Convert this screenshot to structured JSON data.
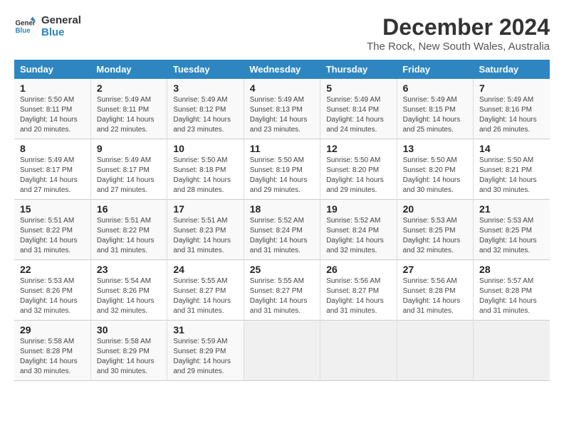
{
  "logo": {
    "line1": "General",
    "line2": "Blue"
  },
  "title": "December 2024",
  "location": "The Rock, New South Wales, Australia",
  "days_of_week": [
    "Sunday",
    "Monday",
    "Tuesday",
    "Wednesday",
    "Thursday",
    "Friday",
    "Saturday"
  ],
  "weeks": [
    [
      {
        "day": "1",
        "sunrise": "5:50 AM",
        "sunset": "8:11 PM",
        "daylight": "14 hours and 20 minutes."
      },
      {
        "day": "2",
        "sunrise": "5:49 AM",
        "sunset": "8:11 PM",
        "daylight": "14 hours and 22 minutes."
      },
      {
        "day": "3",
        "sunrise": "5:49 AM",
        "sunset": "8:12 PM",
        "daylight": "14 hours and 23 minutes."
      },
      {
        "day": "4",
        "sunrise": "5:49 AM",
        "sunset": "8:13 PM",
        "daylight": "14 hours and 23 minutes."
      },
      {
        "day": "5",
        "sunrise": "5:49 AM",
        "sunset": "8:14 PM",
        "daylight": "14 hours and 24 minutes."
      },
      {
        "day": "6",
        "sunrise": "5:49 AM",
        "sunset": "8:15 PM",
        "daylight": "14 hours and 25 minutes."
      },
      {
        "day": "7",
        "sunrise": "5:49 AM",
        "sunset": "8:16 PM",
        "daylight": "14 hours and 26 minutes."
      }
    ],
    [
      {
        "day": "8",
        "sunrise": "5:49 AM",
        "sunset": "8:17 PM",
        "daylight": "14 hours and 27 minutes."
      },
      {
        "day": "9",
        "sunrise": "5:49 AM",
        "sunset": "8:17 PM",
        "daylight": "14 hours and 27 minutes."
      },
      {
        "day": "10",
        "sunrise": "5:50 AM",
        "sunset": "8:18 PM",
        "daylight": "14 hours and 28 minutes."
      },
      {
        "day": "11",
        "sunrise": "5:50 AM",
        "sunset": "8:19 PM",
        "daylight": "14 hours and 29 minutes."
      },
      {
        "day": "12",
        "sunrise": "5:50 AM",
        "sunset": "8:20 PM",
        "daylight": "14 hours and 29 minutes."
      },
      {
        "day": "13",
        "sunrise": "5:50 AM",
        "sunset": "8:20 PM",
        "daylight": "14 hours and 30 minutes."
      },
      {
        "day": "14",
        "sunrise": "5:50 AM",
        "sunset": "8:21 PM",
        "daylight": "14 hours and 30 minutes."
      }
    ],
    [
      {
        "day": "15",
        "sunrise": "5:51 AM",
        "sunset": "8:22 PM",
        "daylight": "14 hours and 31 minutes."
      },
      {
        "day": "16",
        "sunrise": "5:51 AM",
        "sunset": "8:22 PM",
        "daylight": "14 hours and 31 minutes."
      },
      {
        "day": "17",
        "sunrise": "5:51 AM",
        "sunset": "8:23 PM",
        "daylight": "14 hours and 31 minutes."
      },
      {
        "day": "18",
        "sunrise": "5:52 AM",
        "sunset": "8:24 PM",
        "daylight": "14 hours and 31 minutes."
      },
      {
        "day": "19",
        "sunrise": "5:52 AM",
        "sunset": "8:24 PM",
        "daylight": "14 hours and 32 minutes."
      },
      {
        "day": "20",
        "sunrise": "5:53 AM",
        "sunset": "8:25 PM",
        "daylight": "14 hours and 32 minutes."
      },
      {
        "day": "21",
        "sunrise": "5:53 AM",
        "sunset": "8:25 PM",
        "daylight": "14 hours and 32 minutes."
      }
    ],
    [
      {
        "day": "22",
        "sunrise": "5:53 AM",
        "sunset": "8:26 PM",
        "daylight": "14 hours and 32 minutes."
      },
      {
        "day": "23",
        "sunrise": "5:54 AM",
        "sunset": "8:26 PM",
        "daylight": "14 hours and 32 minutes."
      },
      {
        "day": "24",
        "sunrise": "5:55 AM",
        "sunset": "8:27 PM",
        "daylight": "14 hours and 31 minutes."
      },
      {
        "day": "25",
        "sunrise": "5:55 AM",
        "sunset": "8:27 PM",
        "daylight": "14 hours and 31 minutes."
      },
      {
        "day": "26",
        "sunrise": "5:56 AM",
        "sunset": "8:27 PM",
        "daylight": "14 hours and 31 minutes."
      },
      {
        "day": "27",
        "sunrise": "5:56 AM",
        "sunset": "8:28 PM",
        "daylight": "14 hours and 31 minutes."
      },
      {
        "day": "28",
        "sunrise": "5:57 AM",
        "sunset": "8:28 PM",
        "daylight": "14 hours and 31 minutes."
      }
    ],
    [
      {
        "day": "29",
        "sunrise": "5:58 AM",
        "sunset": "8:28 PM",
        "daylight": "14 hours and 30 minutes."
      },
      {
        "day": "30",
        "sunrise": "5:58 AM",
        "sunset": "8:29 PM",
        "daylight": "14 hours and 30 minutes."
      },
      {
        "day": "31",
        "sunrise": "5:59 AM",
        "sunset": "8:29 PM",
        "daylight": "14 hours and 29 minutes."
      },
      null,
      null,
      null,
      null
    ]
  ],
  "labels": {
    "sunrise_prefix": "Sunrise: ",
    "sunset_prefix": "Sunset: ",
    "daylight_prefix": "Daylight: "
  }
}
